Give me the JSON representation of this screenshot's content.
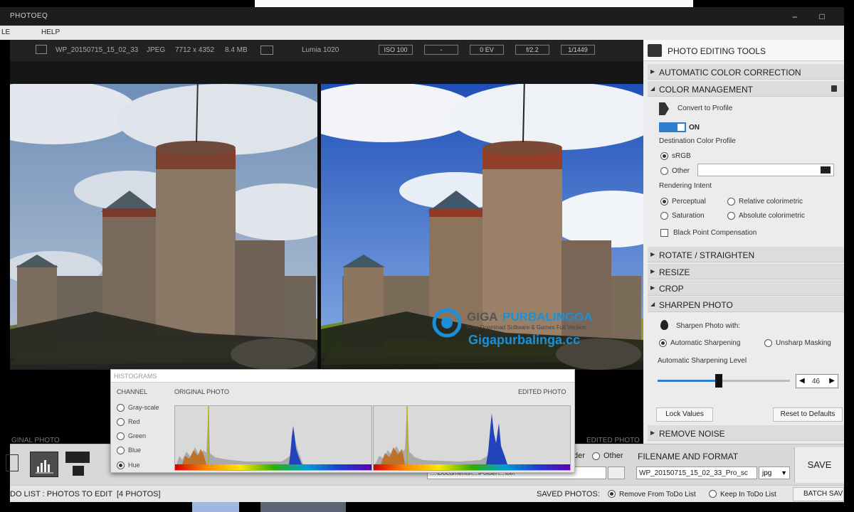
{
  "window": {
    "title": "PHOTOEQ",
    "minimize_glyph": "–",
    "maximize_glyph": "□"
  },
  "menu": {
    "file": "LE",
    "help": "HELP"
  },
  "info": {
    "filename": "WP_20150715_15_02_33",
    "format": "JPEG",
    "dimensions": "7712 x 4352",
    "size": "8.4 MB",
    "camera": "Lumia 1020",
    "iso": "ISO 100",
    "dash": "-",
    "ev": "0 EV",
    "aperture": "f/2.2",
    "shutter": "1/1449",
    "file_icon": "image-file-icon",
    "camera_icon": "camera-icon"
  },
  "photos": {
    "original_label": "GINAL PHOTO",
    "edited_label": "EDITED PHOTO"
  },
  "panel": {
    "title": "PHOTO EDITING TOOLS",
    "title_icon": "sliders-icon",
    "sections": {
      "auto_color": "AUTOMATIC COLOR CORRECTION",
      "color_mgmt": "COLOR MANAGEMENT",
      "rotate": "ROTATE / STRAIGHTEN",
      "resize": "RESIZE",
      "crop": "CROP",
      "sharpen": "SHARPEN PHOTO",
      "noise": "REMOVE NOISE"
    },
    "color_management": {
      "convert_label": "Convert to Profile",
      "toggle_state": "ON",
      "destination_label": "Destination Color Profile",
      "srgb": "sRGB",
      "other": "Other",
      "other_value": "",
      "rendering_label": "Rendering Intent",
      "perceptual": "Perceptual",
      "relative": "Relative colorimetric",
      "saturation": "Saturation",
      "absolute": "Absolute colorimetric",
      "black_point": "Black Point Compensation"
    },
    "sharpen": {
      "with_label": "Sharpen Photo with:",
      "automatic": "Automatic Sharpening",
      "unsharp": "Unsharp Masking",
      "level_label": "Automatic Sharpening Level",
      "level_value": "46",
      "level_fraction": 0.46,
      "lock_button": "Lock Values",
      "reset_button": "Reset to Defaults"
    }
  },
  "histogram": {
    "title": "HISTOGRAMS",
    "channel_label": "CHANNEL",
    "original_label": "ORIGINAL PHOTO",
    "edited_label": "EDITED PHOTO",
    "channels": [
      "Gray-scale",
      "Red",
      "Green",
      "Blue",
      "Hue"
    ],
    "selected": "Hue"
  },
  "bottom": {
    "der_label": "der",
    "other_label": "Other",
    "folder_path": "…\\Documents\\...\\Folder\\...\\oll\\",
    "filename_format_label": "FILENAME AND FORMAT",
    "filename_value": "WP_20150715_15_02_33_Pro_sc",
    "format_value": "jpg",
    "save_button": "SAVE"
  },
  "todo": {
    "label": "DO LIST : PHOTOS TO EDIT",
    "count": "[4 PHOTOS]",
    "saved_label": "SAVED PHOTOS:",
    "remove": "Remove From ToDo List",
    "keep": "Keep In ToDo List",
    "batch": "BATCH SAVE"
  },
  "watermark": {
    "brand_a": "GIGA",
    "brand_b": "PURBALINGGA",
    "tagline": "Free Download Software & Games Full Version",
    "url": "Gigapurbalinga.cc"
  },
  "colors": {
    "accent": "#2f7fd1",
    "panel": "#ececec",
    "dark": "#1d1d1d",
    "watermark": "#1b8fd8"
  }
}
